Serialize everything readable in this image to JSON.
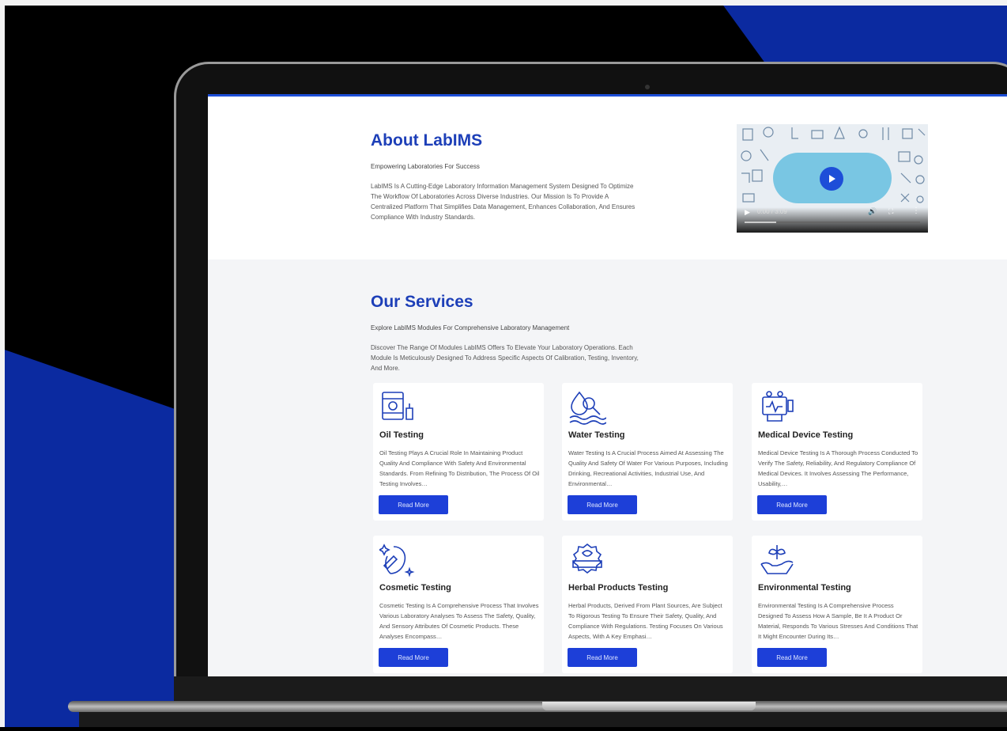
{
  "colors": {
    "accent": "#1d3fb8",
    "button": "#1d3fd8",
    "background_blue": "#0b2aa0"
  },
  "about": {
    "title": "About LabIMS",
    "subtitle": "Empowering Laboratories For Success",
    "description": "LabIMS Is A Cutting-Edge Laboratory Information Management System Designed To Optimize The Workflow Of Laboratories Across Diverse Industries. Our Mission Is To Provide A Centralized Platform That Simplifies Data Management, Enhances Collaboration, And Ensures Compliance With Industry Standards."
  },
  "video": {
    "time": "0:00 / 3:09",
    "progress": 0.18,
    "icons": [
      "play-icon",
      "volume-icon",
      "fullscreen-icon",
      "more-options-icon"
    ]
  },
  "services": {
    "title": "Our Services",
    "subtitle": "Explore LabIMS Modules For Comprehensive Laboratory Management",
    "description": "Discover The Range Of Modules LabIMS Offers To Elevate Your Laboratory Operations. Each Module Is Meticulously Designed To Address Specific Aspects Of Calibration, Testing, Inventory, And More.",
    "cards": [
      {
        "icon": "oil-barrel-icon",
        "title": "Oil Testing",
        "description": "Oil Testing Plays A Crucial Role In Maintaining Product Quality And Compliance With Safety And Environmental Standards. From Refining To Distribution, The Process Of Oil Testing Involves…",
        "button": "Read More"
      },
      {
        "icon": "water-test-icon",
        "title": "Water Testing",
        "description": "Water Testing Is A Crucial Process Aimed At Assessing The Quality And Safety Of Water For Various Purposes, Including Drinking, Recreational Activities, Industrial Use, And Environmental…",
        "button": "Read More"
      },
      {
        "icon": "medical-device-icon",
        "title": "Medical Device Testing",
        "description": "Medical Device Testing Is A Thorough Process Conducted To Verify The Safety, Reliability, And Regulatory Compliance Of Medical Devices. It Involves Assessing The Performance, Usability,…",
        "button": "Read More"
      },
      {
        "icon": "cosmetic-icon",
        "title": "Cosmetic Testing",
        "description": "Cosmetic Testing Is A Comprehensive Process That Involves Various Laboratory Analyses To Assess The Safety, Quality, And Sensory Attributes Of Cosmetic Products. These Analyses Encompass…",
        "button": "Read More"
      },
      {
        "icon": "herbal-natural-icon",
        "title": "Herbal Products Testing",
        "description": "Herbal Products, Derived From Plant Sources, Are Subject To Rigorous Testing To Ensure Their Safety, Quality, And Compliance With Regulations. Testing Focuses On Various Aspects, With A Key Emphasi…",
        "button": "Read More"
      },
      {
        "icon": "environment-icon",
        "title": "Environmental Testing",
        "description": "Environmental Testing Is A Comprehensive Process Designed To Assess How A Sample, Be It A Product Or Material, Responds To Various Stresses And Conditions That It Might Encounter During Its…",
        "button": "Read More"
      }
    ]
  }
}
